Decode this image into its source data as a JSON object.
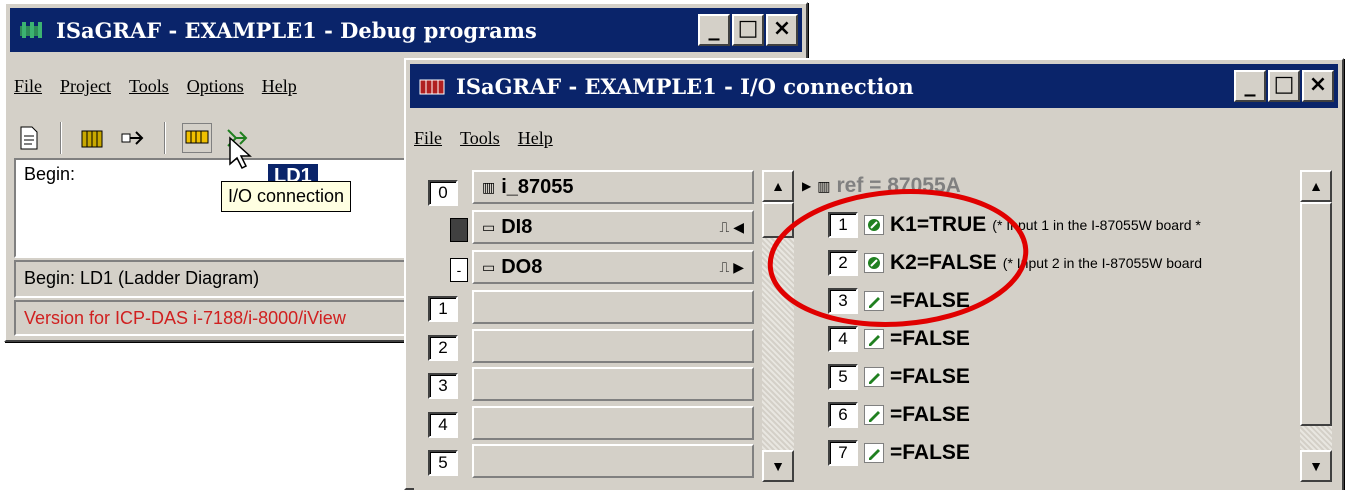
{
  "debug_window": {
    "title": "ISaGRAF - EXAMPLE1 - Debug programs",
    "menu": [
      "File",
      "Project",
      "Tools",
      "Options",
      "Help"
    ],
    "content_label": "Begin:",
    "selected_program": "LD1",
    "tooltip": "I/O connection",
    "status_line": "Begin:  LD1  (Ladder Diagram)",
    "version_line": "Version for ICP-DAS i-7188/i-8000/iView"
  },
  "io_window": {
    "title": "ISaGRAF - EXAMPLE1 - I/O connection",
    "menu": [
      "File",
      "Tools",
      "Help"
    ],
    "slots": [
      {
        "num": "0",
        "label": "i_87055"
      },
      {
        "num": "",
        "label": "DI8"
      },
      {
        "num": "",
        "label": "DO8"
      },
      {
        "num": "1",
        "label": ""
      },
      {
        "num": "2",
        "label": ""
      },
      {
        "num": "3",
        "label": ""
      },
      {
        "num": "4",
        "label": ""
      },
      {
        "num": "5",
        "label": ""
      }
    ],
    "ref_text": "ref = 87055A",
    "channels": [
      {
        "num": "1",
        "var": "K1=TRUE",
        "comment": "(* Input 1 in the I-87055W board *"
      },
      {
        "num": "2",
        "var": "K2=FALSE",
        "comment": "(* Input 2 in the I-87055W board"
      },
      {
        "num": "3",
        "var": "=FALSE",
        "comment": ""
      },
      {
        "num": "4",
        "var": "=FALSE",
        "comment": ""
      },
      {
        "num": "5",
        "var": "=FALSE",
        "comment": ""
      },
      {
        "num": "6",
        "var": "=FALSE",
        "comment": ""
      },
      {
        "num": "7",
        "var": "=FALSE",
        "comment": ""
      }
    ]
  },
  "colors": {
    "titlebar": "#0a246a",
    "face": "#d4d0c8",
    "annotation": "#e00000",
    "version_text": "#d02020"
  }
}
